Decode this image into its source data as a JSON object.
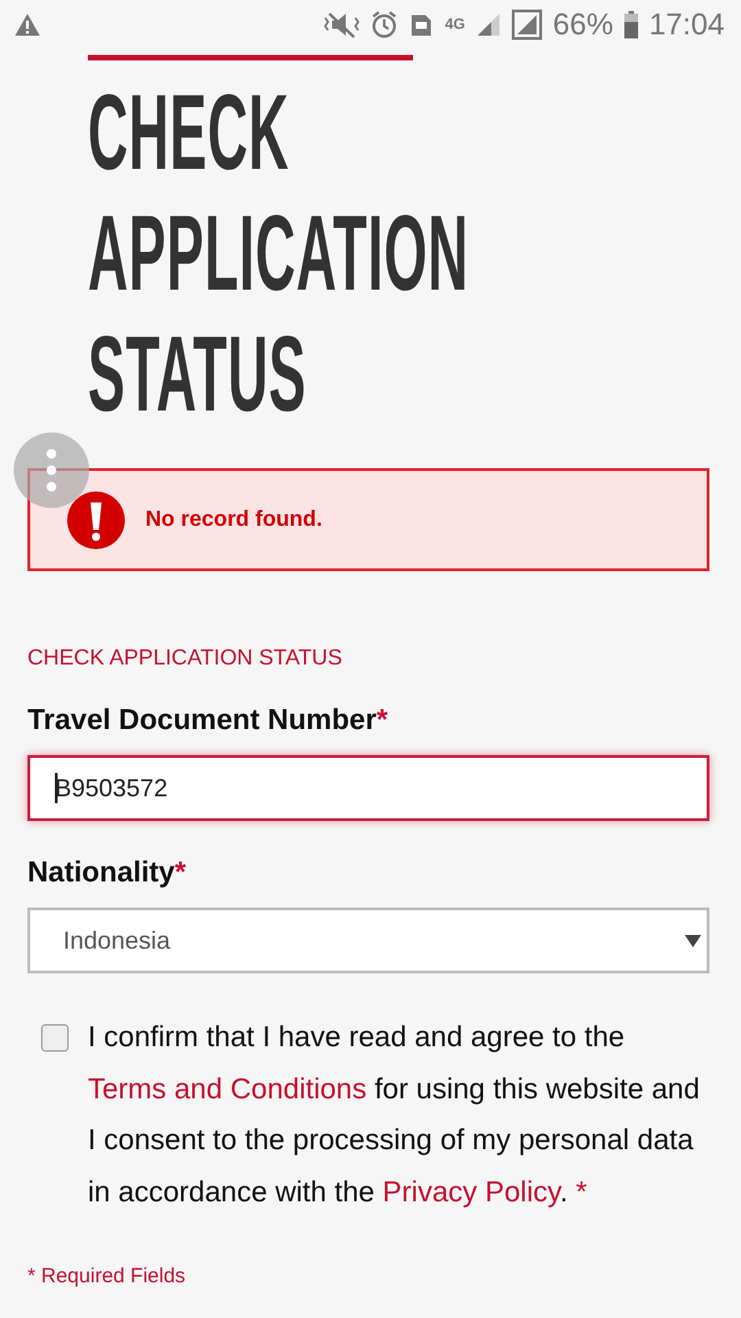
{
  "status_bar": {
    "network": "4G",
    "battery": "66%",
    "time": "17:04"
  },
  "heading": "CHECK APPLICATION STATUS",
  "alert": {
    "message": "No record found."
  },
  "section_title": "CHECK APPLICATION STATUS",
  "fields": [
    {
      "kind": "text",
      "label": "Travel Document Number",
      "required_mark": "*",
      "value": "B9503572",
      "invalid": true
    },
    {
      "kind": "select",
      "label": "Nationality",
      "required_mark": "*",
      "value": "Indonesia",
      "invalid": false
    }
  ],
  "consent": {
    "checked": false,
    "parts": [
      {
        "kind": "text",
        "text": "I confirm that I have read and agree to the "
      },
      {
        "kind": "link",
        "text": "Terms and Conditions"
      },
      {
        "kind": "text",
        "text": " for using this website and I consent to the processing of my personal data in accordance with the "
      },
      {
        "kind": "link",
        "text": "Privacy Policy"
      },
      {
        "kind": "text",
        "text": ". "
      },
      {
        "kind": "required",
        "text": "*"
      }
    ]
  },
  "required_note": "* Required Fields"
}
